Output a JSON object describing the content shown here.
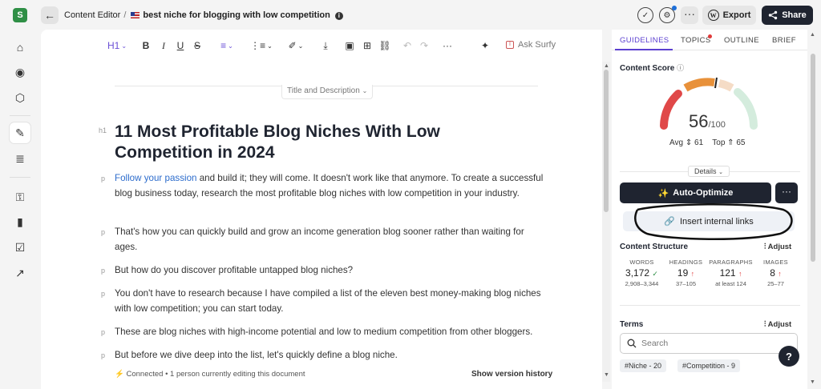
{
  "app": {
    "logo_letter": "S"
  },
  "breadcrumb": {
    "section": "Content Editor",
    "separator": "/",
    "doc_title": "best niche for blogging with low competition"
  },
  "top_actions": {
    "more": "···",
    "export": "Export",
    "share": "Share"
  },
  "toolbar": {
    "heading": "H1",
    "ask_surfy": "Ask Surfy"
  },
  "editor": {
    "title_desc_toggle": "Title and Description",
    "h1_tag": "h1",
    "h1": "11 Most Profitable Blog Niches With Low Competition in 2024",
    "p_tag": "p",
    "para1_link": "Follow your passion",
    "para1_rest": " and build it; they will come. It doesn't work like that anymore. To create a successful blog business today, research the most profitable blog niches with low competition in your industry.",
    "para2": "That's how you can quickly build and grow an income generation blog sooner rather than waiting for ages.",
    "para3": "But how do you discover profitable untapped blog niches?",
    "para4": "You don't have to research because I have compiled a list of the eleven best money-making blog niches with low competition; you can start today.",
    "para5": "These are blog niches with high-income potential and low to medium competition from other bloggers.",
    "para6": "But before we dive deep into the list, let's quickly define a blog niche.",
    "footer_status": "Connected • 1 person currently editing this document",
    "version_history": "Show version history"
  },
  "panel": {
    "tabs": [
      "GUIDELINES",
      "TOPICS",
      "OUTLINE",
      "BRIEF"
    ],
    "content_score_title": "Content Score",
    "score": "56",
    "score_max": "/100",
    "score_value": 56,
    "avg_label": "Avg",
    "avg_value": "61",
    "top_label": "Top",
    "top_value": "65",
    "details": "Details",
    "auto_optimize": "Auto-Optimize",
    "auto_optimize_more": "···",
    "insert_links": "Insert internal links",
    "content_structure": "Content Structure",
    "adjust": "Adjust",
    "stats": [
      {
        "label": "WORDS",
        "value": "3,172",
        "status": "ok",
        "range": "2,908–3,344"
      },
      {
        "label": "HEADINGS",
        "value": "19",
        "status": "up",
        "range": "37–105"
      },
      {
        "label": "PARAGRAPHS",
        "value": "121",
        "status": "up",
        "range": "at least 124"
      },
      {
        "label": "IMAGES",
        "value": "8",
        "status": "up",
        "range": "25–77"
      }
    ],
    "terms_title": "Terms",
    "search_placeholder": "Search",
    "chips": [
      "#Niche - 20",
      "#Competition - 9"
    ]
  },
  "colors": {
    "accent": "#5b3fd0",
    "dark": "#1f2430",
    "gauge_red": "#e04848",
    "gauge_orange": "#e8913a",
    "gauge_light_orange": "#f5dcc6",
    "gauge_green": "#d4ecdd"
  }
}
